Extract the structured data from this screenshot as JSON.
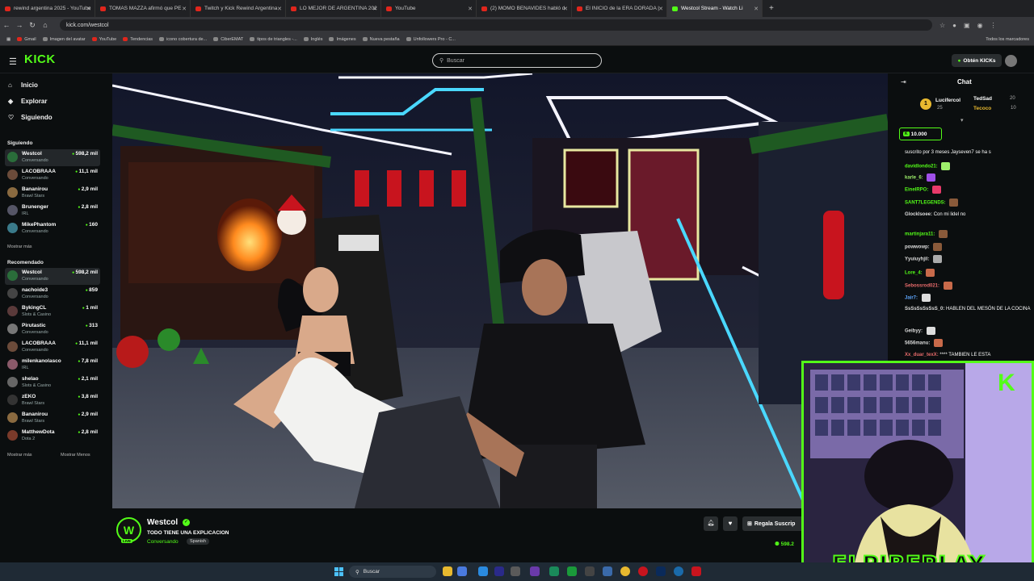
{
  "browser": {
    "tabs": [
      {
        "title": "rewind argentina 2025 - YouTube"
      },
      {
        "title": "TOMAS MAZZA afirmó que PE"
      },
      {
        "title": "Twitch y Kick Rewind Argentina"
      },
      {
        "title": "LO MEJOR DE ARGENTINA 202"
      },
      {
        "title": "YouTube"
      },
      {
        "title": "(2) MOMO BENAVIDES habló d"
      },
      {
        "title": "El INICIO de la ERA DORADA |"
      },
      {
        "title": "Westcol Stream - Watch Li"
      }
    ],
    "new_tab": "+",
    "url": "kick.com/westcol",
    "bookmarks": [
      "Gmail",
      "Imagen del avatar",
      "YouTube",
      "Tendencias",
      "icono cobertura de...",
      "CiberEMAT",
      "tipos de triangles -...",
      "Inglés",
      "Imágenes",
      "Nueva pestaña",
      "Unfollowers Pro - C..."
    ],
    "all_bookmarks": "Todos los marcadores"
  },
  "header": {
    "logo": "KICK",
    "search_placeholder": "Buscar",
    "get_kicks": "Obtén KICKs"
  },
  "sidebar": {
    "nav": [
      {
        "label": "Inicio",
        "icon": "home-icon"
      },
      {
        "label": "Explorar",
        "icon": "compass-icon"
      },
      {
        "label": "Siguiendo",
        "icon": "heart-icon"
      }
    ],
    "following_title": "Siguiendo",
    "following": [
      {
        "name": "Westcol",
        "category": "Conversando",
        "viewers": "598,2 mil",
        "color": "#2a6d3a"
      },
      {
        "name": "LACOBRAAA",
        "category": "Conversando",
        "viewers": "11,1 mil",
        "color": "#6b4b3a"
      },
      {
        "name": "Bananirou",
        "category": "Brawl Stars",
        "viewers": "2,9 mil",
        "color": "#8a6a40"
      },
      {
        "name": "Brunenger",
        "category": "IRL",
        "viewers": "2,8 mil",
        "color": "#556"
      },
      {
        "name": "MikePhantom",
        "category": "Conversando",
        "viewers": "160",
        "color": "#3a7a8a"
      }
    ],
    "show_more": "Mostrar más",
    "recommended_title": "Recomendado",
    "recommended": [
      {
        "name": "Westcol",
        "category": "Conversando",
        "viewers": "598,2 mil",
        "color": "#2a6d3a"
      },
      {
        "name": "nachoide3",
        "category": "Conversando",
        "viewers": "859",
        "color": "#444"
      },
      {
        "name": "BykingCL",
        "category": "Slots & Casino",
        "viewers": "1 mil",
        "color": "#5a3a3a"
      },
      {
        "name": "Pirutastic",
        "category": "Conversando",
        "viewers": "313",
        "color": "#777"
      },
      {
        "name": "LACOBRAAA",
        "category": "Conversando",
        "viewers": "11,1 mil",
        "color": "#6b4b3a"
      },
      {
        "name": "milenkanolasco",
        "category": "IRL",
        "viewers": "7,8 mil",
        "color": "#8a5a6a"
      },
      {
        "name": "shelao",
        "category": "Slots & Casino",
        "viewers": "2,1 mil",
        "color": "#666"
      },
      {
        "name": "zEKO",
        "category": "Brawl Stars",
        "viewers": "3,8 mil",
        "color": "#333"
      },
      {
        "name": "Bananirou",
        "category": "Brawl Stars",
        "viewers": "2,9 mil",
        "color": "#8a6a40"
      },
      {
        "name": "MatthewDota",
        "category": "Dota 2",
        "viewers": "2,8 mil",
        "color": "#7a3a2a"
      }
    ],
    "show_more_2": "Mostrar más",
    "show_less": "Mostrar Menos"
  },
  "stream": {
    "streamer": "Westcol",
    "avatar_letter": "W",
    "live": "LIVE",
    "title": "TODO TIENE UNA EXPLICACION",
    "category": "Conversando",
    "tag": "Spanish",
    "subscribe_label": "Regala Suscrip",
    "viewers": "598.2"
  },
  "chat": {
    "title": "Chat",
    "leaders": [
      {
        "name": "Lucifercol",
        "value": "25"
      },
      {
        "name": "TedSad",
        "value": "20"
      },
      {
        "name": "Tecoco",
        "value": "10"
      }
    ],
    "pinned_amount": "10.000",
    "messages": [
      {
        "user": "",
        "text": "suscrito por 3 meses  Jayseven7 se ha s",
        "color": "#ccc"
      },
      {
        "user": "davidlondo21:",
        "text": "",
        "color": "#53fc18"
      },
      {
        "user": "karle_6:",
        "text": "",
        "color": "#9ef06b"
      },
      {
        "user": "EinelRPO:",
        "text": "",
        "color": "#53fc18"
      },
      {
        "user": "SANT7LEGENDS:",
        "text": "",
        "color": "#53fc18"
      },
      {
        "user": "Glocklsoee:",
        "text": "Con mi lidel no",
        "color": "#ddd"
      },
      {
        "user": "martinjara11:",
        "text": "",
        "color": "#53fc18"
      },
      {
        "user": "powwowp:",
        "text": "",
        "color": "#ddd"
      },
      {
        "user": "Yyuiuyhjil:",
        "text": "",
        "color": "#ddd"
      },
      {
        "user": "Lore_4:",
        "text": "",
        "color": "#53fc18"
      },
      {
        "user": "Sebossrod021:",
        "text": "",
        "color": "#e86b6b"
      },
      {
        "user": "Jair7:",
        "text": "",
        "color": "#5fa8ff"
      },
      {
        "user": "SsSsSsSsSsS_0:",
        "text": "HABLEN DEL MESÓN DE LA COCINA",
        "color": "#ddd"
      },
      {
        "user": "Geibyy:",
        "text": "",
        "color": "#ddd"
      },
      {
        "user": "5656manu:",
        "text": "",
        "color": "#ddd"
      },
      {
        "user": "Xx_duar_texX:",
        "text": "**** TAMBIEN LE ESTA",
        "color": "#e86b6b"
      }
    ]
  },
  "webcam": {
    "overlay_text": "ELPIBEPLAY",
    "logo": "K"
  },
  "taskbar": {
    "search": "Buscar"
  },
  "colors": {
    "accent": "#53fc18",
    "bg": "#0b0e0f"
  }
}
